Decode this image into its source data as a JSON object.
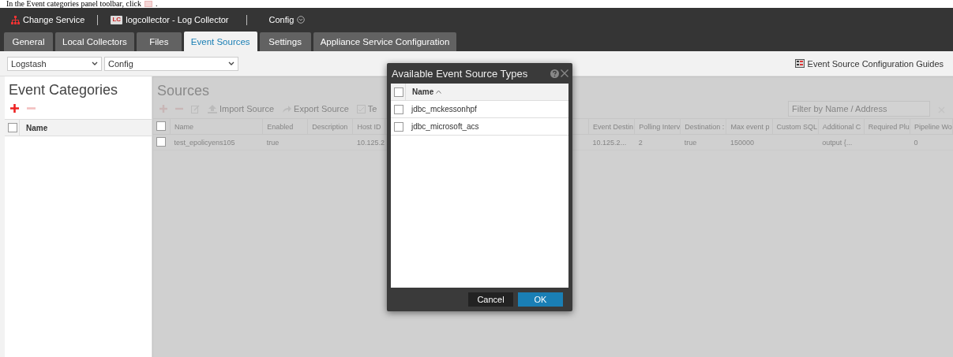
{
  "instruction": {
    "text": "In the Event categories panel toolbar, click",
    "end": "."
  },
  "header": {
    "change_service": "Change Service",
    "service_badge": "LC",
    "service": "logcollector - Log Collector",
    "view": "Config"
  },
  "tabs": [
    {
      "label": "General",
      "selected": false
    },
    {
      "label": "Local Collectors",
      "selected": false
    },
    {
      "label": "Files",
      "selected": false
    },
    {
      "label": "Event Sources",
      "selected": true
    },
    {
      "label": "Settings",
      "selected": false
    },
    {
      "label": "Appliance Service Configuration",
      "selected": false
    }
  ],
  "toolbar": {
    "selects": [
      {
        "value": "Logstash"
      },
      {
        "value": "Config"
      }
    ],
    "guides_link": "Event Source Configuration Guides"
  },
  "categories_panel": {
    "title": "Event Categories",
    "add": {
      "disabled": false
    },
    "remove": {
      "disabled": true
    },
    "select_all_checked": false,
    "columns": [
      "Name"
    ]
  },
  "sources_panel": {
    "title": "Sources",
    "actions": [
      {
        "kind": "add"
      },
      {
        "kind": "remove"
      },
      {
        "kind": "edit"
      },
      {
        "kind": "import",
        "label": "Import Source"
      },
      {
        "kind": "export",
        "label": "Export Source"
      },
      {
        "kind": "test",
        "label": "Te"
      }
    ],
    "filter": {
      "placeholder": "Filter by Name / Address"
    },
    "select_all_checked": false,
    "row_checked": false,
    "columns_left": [
      {
        "label": "Name",
        "row_value": "test_epolicyens105"
      },
      {
        "label": "Enabled",
        "row_value": "true"
      },
      {
        "label": "Description"
      },
      {
        "label": "Host ID",
        "row_value": "10.125.2"
      }
    ],
    "columns_right": [
      {
        "label": "Event Destin",
        "row_value": "10.125.2..."
      },
      {
        "label": "Polling Interv",
        "row_value": "2"
      },
      {
        "label": "Destination :",
        "row_value": "true"
      },
      {
        "label": "Max event p",
        "row_value": "150000"
      },
      {
        "label": "Custom SQL"
      },
      {
        "label": "Additional C",
        "row_value": "output {..."
      },
      {
        "label": "Required Plu"
      },
      {
        "label": "Pipeline Wo",
        "row_value": "0"
      }
    ]
  },
  "dialog": {
    "title": "Available Event Source Types",
    "select_all_checked": false,
    "column": {
      "label": "Name",
      "sorted_ascending": true
    },
    "items": [
      {
        "label": "jdbc_mckessonhpf",
        "checked": false
      },
      {
        "label": "jdbc_microsoft_acs",
        "checked": false
      }
    ],
    "buttons": [
      {
        "label": "Cancel",
        "kind": "secondary"
      },
      {
        "label": "OK",
        "kind": "primary"
      }
    ]
  }
}
